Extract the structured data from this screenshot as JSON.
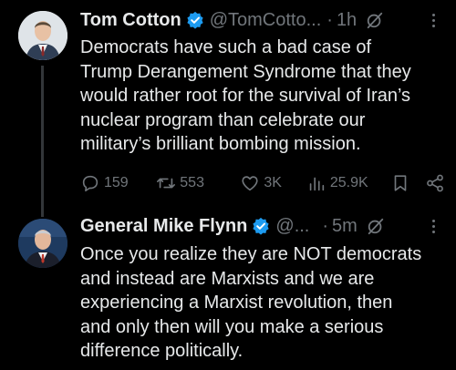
{
  "tweets": [
    {
      "name": "Tom Cotton",
      "handle": "@TomCotto...",
      "dot": "·",
      "time": "1h",
      "text": "Democrats have such a bad case of\nTrump Derangement Syndrome that they\nwould rather root for the survival of Iran’s\nnuclear program than celebrate our\nmilitary’s brilliant bombing mission.",
      "replies": "159",
      "reposts": "553",
      "likes": "3K",
      "views": "25.9K"
    },
    {
      "name": "General Mike Flynn",
      "handle": "@...",
      "dot": "·",
      "time": "5m",
      "text": "Once you realize they are NOT democrats\nand instead are Marxists and we are\nexperiencing a Marxist revolution, then\nand only then will you make a serious\ndifference politically."
    }
  ],
  "icons": {
    "verified": "verified-badge-icon",
    "grok": "grok-icon",
    "more": "more-icon",
    "reply": "reply-icon",
    "repost": "repost-icon",
    "like": "like-icon",
    "views": "views-icon",
    "bookmark": "bookmark-icon",
    "share": "share-icon"
  },
  "colors": {
    "background": "#000000",
    "text": "#e7e9ea",
    "muted": "#71767b",
    "verified": "#1d9bf0",
    "thread_line": "#333639"
  }
}
